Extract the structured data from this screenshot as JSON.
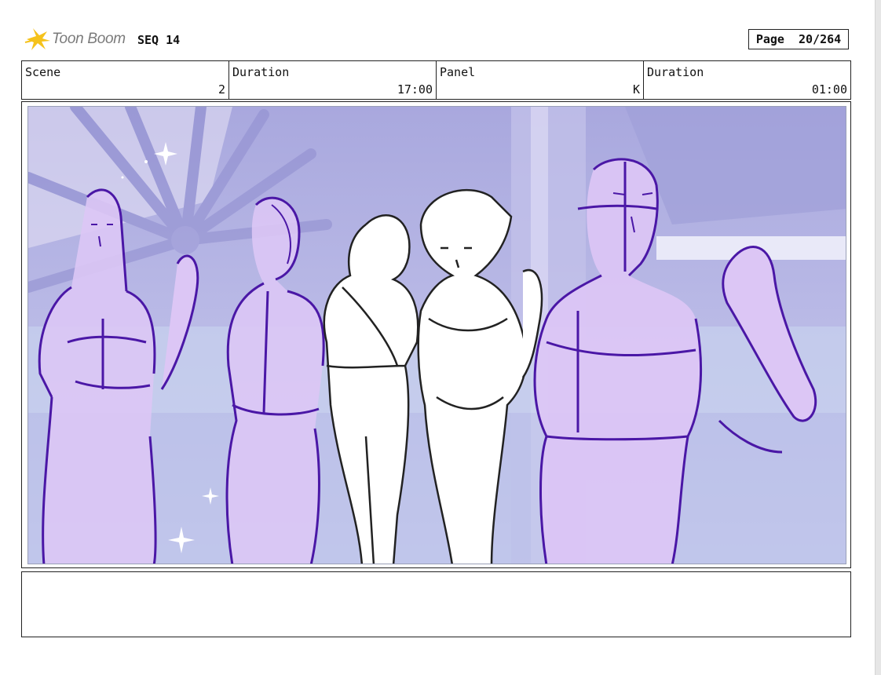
{
  "header": {
    "logo_text": "Toon Boom",
    "sequence": "SEQ 14",
    "page": "Page  20/264"
  },
  "info": {
    "scene_label": "Scene",
    "scene_value": "2",
    "scene_duration_label": "Duration",
    "scene_duration_value": "17:00",
    "panel_label": "Panel",
    "panel_value": "K",
    "panel_duration_label": "Duration",
    "panel_duration_value": "01:00"
  },
  "colors": {
    "logo_yellow": "#f5c21b",
    "background_lavender": "#b8b7e3",
    "sketch_fill": "#dcc6f5",
    "sketch_line": "#4a17a6",
    "ink_line": "#222222"
  },
  "notes": {
    "text": ""
  }
}
